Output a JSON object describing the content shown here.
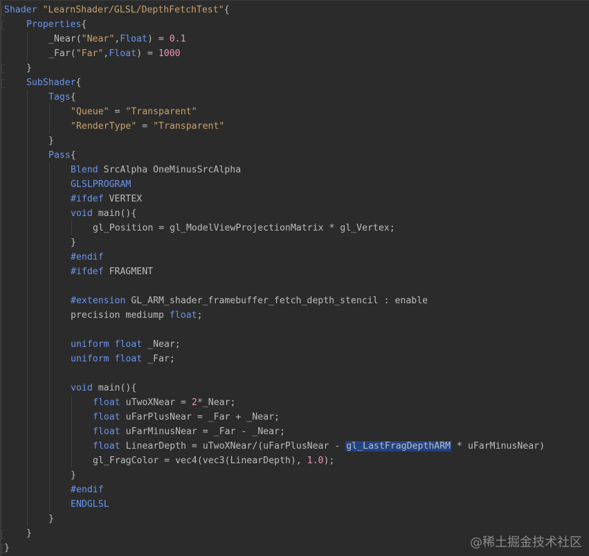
{
  "editor": {
    "lines": [
      {
        "indent": 0,
        "tokens": [
          {
            "t": "Shader ",
            "c": "kw"
          },
          {
            "t": "\"LearnShader/GLSL/DepthFetchTest\"",
            "c": "str"
          },
          {
            "t": "{",
            "c": "plain"
          }
        ]
      },
      {
        "indent": 1,
        "tokens": [
          {
            "t": "Properties",
            "c": "kw"
          },
          {
            "t": "{",
            "c": "plain"
          }
        ]
      },
      {
        "indent": 2,
        "tokens": [
          {
            "t": "_Near(",
            "c": "plain"
          },
          {
            "t": "\"Near\"",
            "c": "str"
          },
          {
            "t": ",",
            "c": "plain"
          },
          {
            "t": "Float",
            "c": "kw"
          },
          {
            "t": ") = ",
            "c": "plain"
          },
          {
            "t": "0.1",
            "c": "num"
          }
        ]
      },
      {
        "indent": 2,
        "tokens": [
          {
            "t": "_Far(",
            "c": "plain"
          },
          {
            "t": "\"Far\"",
            "c": "str"
          },
          {
            "t": ",",
            "c": "plain"
          },
          {
            "t": "Float",
            "c": "kw"
          },
          {
            "t": ") = ",
            "c": "plain"
          },
          {
            "t": "1000",
            "c": "num"
          }
        ]
      },
      {
        "indent": 1,
        "tokens": [
          {
            "t": "}",
            "c": "plain"
          }
        ]
      },
      {
        "indent": 1,
        "tokens": [
          {
            "t": "SubShader",
            "c": "kw"
          },
          {
            "t": "{",
            "c": "plain"
          }
        ]
      },
      {
        "indent": 2,
        "tokens": [
          {
            "t": "Tags",
            "c": "kw"
          },
          {
            "t": "{",
            "c": "plain"
          }
        ]
      },
      {
        "indent": 3,
        "tokens": [
          {
            "t": "\"Queue\"",
            "c": "str"
          },
          {
            "t": " = ",
            "c": "plain"
          },
          {
            "t": "\"Transparent\"",
            "c": "str"
          }
        ]
      },
      {
        "indent": 3,
        "tokens": [
          {
            "t": "\"RenderType\"",
            "c": "str"
          },
          {
            "t": " = ",
            "c": "plain"
          },
          {
            "t": "\"Transparent\"",
            "c": "str"
          }
        ]
      },
      {
        "indent": 2,
        "tokens": [
          {
            "t": "}",
            "c": "plain"
          }
        ]
      },
      {
        "indent": 2,
        "tokens": [
          {
            "t": "Pass",
            "c": "kw"
          },
          {
            "t": "{",
            "c": "plain"
          }
        ]
      },
      {
        "indent": 3,
        "tokens": [
          {
            "t": "Blend ",
            "c": "kw"
          },
          {
            "t": "SrcAlpha OneMinusSrcAlpha",
            "c": "plain"
          }
        ]
      },
      {
        "indent": 3,
        "tokens": [
          {
            "t": "GLSLPROGRAM",
            "c": "kw"
          }
        ]
      },
      {
        "indent": 3,
        "tokens": [
          {
            "t": "#ifdef ",
            "c": "kw"
          },
          {
            "t": "VERTEX",
            "c": "plain"
          }
        ]
      },
      {
        "indent": 3,
        "tokens": [
          {
            "t": "void ",
            "c": "kw"
          },
          {
            "t": "main(){",
            "c": "plain"
          }
        ]
      },
      {
        "indent": 4,
        "tokens": [
          {
            "t": "gl_Position = gl_ModelViewProjectionMatrix * gl_Vertex;",
            "c": "plain"
          }
        ]
      },
      {
        "indent": 3,
        "tokens": [
          {
            "t": "}",
            "c": "plain"
          }
        ]
      },
      {
        "indent": 3,
        "tokens": [
          {
            "t": "#endif",
            "c": "kw"
          }
        ]
      },
      {
        "indent": 3,
        "tokens": [
          {
            "t": "#ifdef ",
            "c": "kw"
          },
          {
            "t": "FRAGMENT",
            "c": "plain"
          }
        ]
      },
      {
        "indent": 3,
        "tokens": []
      },
      {
        "indent": 3,
        "tokens": [
          {
            "t": "#extension ",
            "c": "kw"
          },
          {
            "t": "GL_ARM_shader_framebuffer_fetch_depth_stencil : enable",
            "c": "plain"
          }
        ]
      },
      {
        "indent": 3,
        "tokens": [
          {
            "t": "precision mediump ",
            "c": "plain"
          },
          {
            "t": "float",
            "c": "kw"
          },
          {
            "t": ";",
            "c": "plain"
          }
        ]
      },
      {
        "indent": 3,
        "tokens": []
      },
      {
        "indent": 3,
        "tokens": [
          {
            "t": "uniform ",
            "c": "kw"
          },
          {
            "t": "float ",
            "c": "kw"
          },
          {
            "t": "_Near;",
            "c": "plain"
          }
        ]
      },
      {
        "indent": 3,
        "tokens": [
          {
            "t": "uniform ",
            "c": "kw"
          },
          {
            "t": "float ",
            "c": "kw"
          },
          {
            "t": "_Far;",
            "c": "plain"
          }
        ]
      },
      {
        "indent": 3,
        "tokens": []
      },
      {
        "indent": 3,
        "tokens": [
          {
            "t": "void ",
            "c": "kw"
          },
          {
            "t": "main(){",
            "c": "plain"
          }
        ]
      },
      {
        "indent": 4,
        "tokens": [
          {
            "t": "float ",
            "c": "kw"
          },
          {
            "t": "uTwoXNear = ",
            "c": "plain"
          },
          {
            "t": "2",
            "c": "num"
          },
          {
            "t": "*_Near;",
            "c": "plain"
          }
        ]
      },
      {
        "indent": 4,
        "tokens": [
          {
            "t": "float ",
            "c": "kw"
          },
          {
            "t": "uFarPlusNear = _Far + _Near;",
            "c": "plain"
          }
        ]
      },
      {
        "indent": 4,
        "tokens": [
          {
            "t": "float ",
            "c": "kw"
          },
          {
            "t": "uFarMinusNear = _Far - _Near;",
            "c": "plain"
          }
        ]
      },
      {
        "indent": 4,
        "tokens": [
          {
            "t": "float ",
            "c": "kw"
          },
          {
            "t": "LinearDepth = uTwoXNear/(uFarPlusNear - ",
            "c": "plain"
          },
          {
            "t": "gl_LastFragDepthARM",
            "c": "plain",
            "hl": true
          },
          {
            "t": " * uFarMinusNear)",
            "c": "plain"
          }
        ]
      },
      {
        "indent": 4,
        "tokens": [
          {
            "t": "gl_FragColor = vec4(vec3(LinearDepth), ",
            "c": "plain"
          },
          {
            "t": "1.0",
            "c": "num"
          },
          {
            "t": ");",
            "c": "plain"
          }
        ]
      },
      {
        "indent": 3,
        "tokens": [
          {
            "t": "}",
            "c": "plain"
          }
        ]
      },
      {
        "indent": 3,
        "tokens": [
          {
            "t": "#endif",
            "c": "kw"
          }
        ]
      },
      {
        "indent": 3,
        "tokens": [
          {
            "t": "ENDGLSL",
            "c": "kw"
          }
        ]
      },
      {
        "indent": 2,
        "tokens": [
          {
            "t": "}",
            "c": "plain"
          }
        ]
      },
      {
        "indent": 1,
        "tokens": [
          {
            "t": "}",
            "c": "plain"
          }
        ]
      },
      {
        "indent": 0,
        "tokens": [
          {
            "t": "}",
            "c": "plain"
          }
        ]
      }
    ]
  },
  "watermark": "@稀土掘金技术社区",
  "colors": {
    "background": "#2b2b2b",
    "keyword": "#6c95eb",
    "string": "#c9a26d",
    "number": "#ed94c0",
    "text": "#bdbdbd",
    "highlight": "#214283"
  }
}
